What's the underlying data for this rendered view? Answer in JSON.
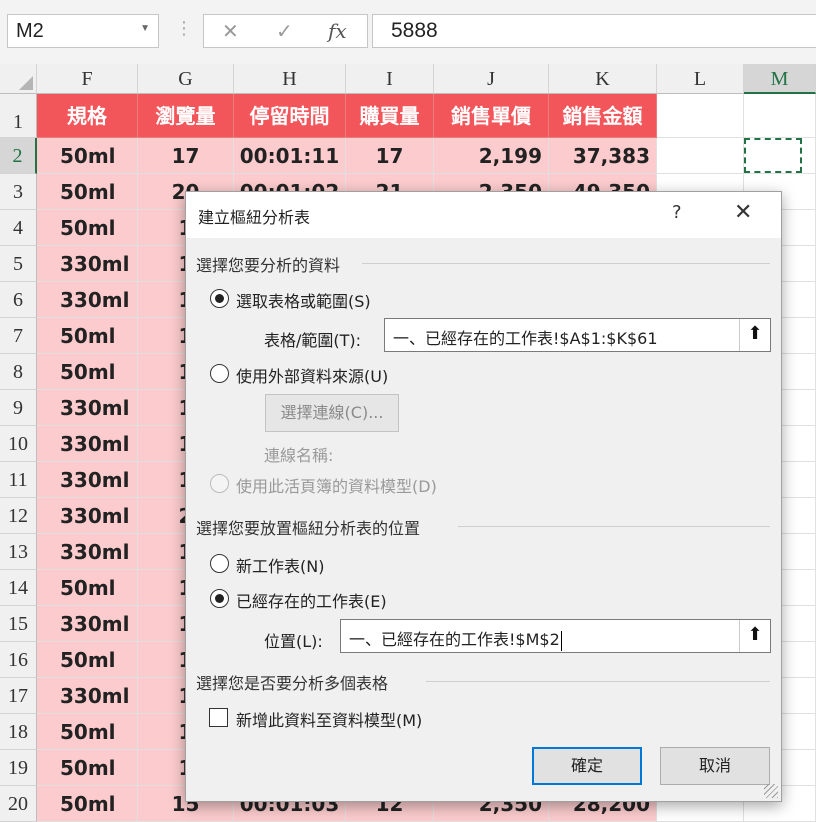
{
  "formula_bar": {
    "name_box": "M2",
    "cancel_glyph": "✕",
    "enter_glyph": "✓",
    "fx_label": "fx",
    "value": "5888"
  },
  "columns": [
    "F",
    "G",
    "H",
    "I",
    "J",
    "K",
    "L",
    "M"
  ],
  "header_row": [
    "規格",
    "瀏覽量",
    "停留時間",
    "購買量",
    "銷售單價",
    "銷售金額"
  ],
  "rows": [
    {
      "num": "1"
    },
    {
      "num": "2",
      "cells": [
        "50ml",
        "17",
        "00:01:11",
        "17",
        "2,199",
        "37,383"
      ]
    },
    {
      "num": "3",
      "cells": [
        "50ml",
        "20",
        "00:01:02",
        "21",
        "2,350",
        "49,350"
      ]
    },
    {
      "num": "4",
      "cells": [
        "50ml",
        "1",
        "",
        "",
        "",
        ""
      ]
    },
    {
      "num": "5",
      "cells": [
        "330ml",
        "1",
        "",
        "",
        "",
        ""
      ]
    },
    {
      "num": "6",
      "cells": [
        "330ml",
        "1",
        "",
        "",
        "",
        ""
      ]
    },
    {
      "num": "7",
      "cells": [
        "50ml",
        "1",
        "",
        "",
        "",
        ""
      ]
    },
    {
      "num": "8",
      "cells": [
        "50ml",
        "1",
        "",
        "",
        "",
        ""
      ]
    },
    {
      "num": "9",
      "cells": [
        "330ml",
        "1",
        "",
        "",
        "",
        ""
      ]
    },
    {
      "num": "10",
      "cells": [
        "330ml",
        "1",
        "",
        "",
        "",
        ""
      ]
    },
    {
      "num": "11",
      "cells": [
        "330ml",
        "1",
        "",
        "",
        "",
        ""
      ]
    },
    {
      "num": "12",
      "cells": [
        "330ml",
        "2",
        "",
        "",
        "",
        ""
      ]
    },
    {
      "num": "13",
      "cells": [
        "330ml",
        "1",
        "",
        "",
        "",
        ""
      ]
    },
    {
      "num": "14",
      "cells": [
        "50ml",
        "1",
        "",
        "",
        "",
        ""
      ]
    },
    {
      "num": "15",
      "cells": [
        "330ml",
        "1",
        "",
        "",
        "",
        ""
      ]
    },
    {
      "num": "16",
      "cells": [
        "50ml",
        "1",
        "",
        "",
        "",
        ""
      ]
    },
    {
      "num": "17",
      "cells": [
        "330ml",
        "1",
        "",
        "",
        "",
        ""
      ]
    },
    {
      "num": "18",
      "cells": [
        "50ml",
        "1",
        "",
        "",
        "",
        ""
      ]
    },
    {
      "num": "19",
      "cells": [
        "50ml",
        "1",
        "",
        "",
        "",
        ""
      ]
    },
    {
      "num": "20",
      "cells": [
        "50ml",
        "15",
        "00:01:03",
        "12",
        "2,350",
        "28,200"
      ]
    }
  ],
  "dialog": {
    "title": "建立樞紐分析表",
    "help": "?",
    "close": "✕",
    "section1": "選擇您要分析的資料",
    "opt_select_range": "選取表格或範圍(S)",
    "range_label": "表格/範圍(T):",
    "range_value": "一、已經存在的工作表!$A$1:$K$61",
    "opt_external": "使用外部資料來源(U)",
    "choose_conn": "選擇連線(C)...",
    "conn_name": "連線名稱:",
    "opt_data_model": "使用此活頁簿的資料模型(D)",
    "section2": "選擇您要放置樞紐分析表的位置",
    "opt_new_sheet": "新工作表(N)",
    "opt_existing_sheet": "已經存在的工作表(E)",
    "location_label": "位置(L):",
    "location_value": "一、已經存在的工作表!$M$2",
    "section3": "選擇您是否要分析多個表格",
    "add_to_model": "新增此資料至資料模型(M)",
    "ok": "確定",
    "cancel": "取消",
    "picker_glyph": "⬆"
  }
}
